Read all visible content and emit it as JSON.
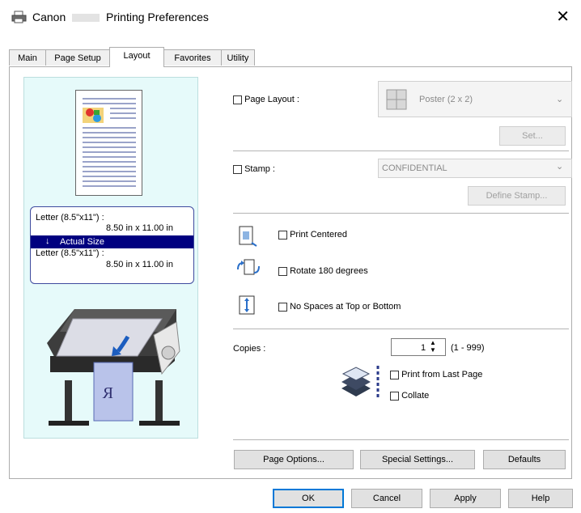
{
  "window": {
    "title_prefix": "Canon",
    "title_suffix": "Printing Preferences",
    "close_glyph": "✕"
  },
  "tabs": [
    {
      "label": "Main"
    },
    {
      "label": "Page Setup"
    },
    {
      "label": "Layout"
    },
    {
      "label": "Favorites"
    },
    {
      "label": "Utility"
    }
  ],
  "active_tab": "Layout",
  "preview": {
    "paper_from_name": "Letter (8.5\"x11\") :",
    "paper_from_size": "8.50 in x 11.00 in",
    "scaling_label": "Actual Size",
    "paper_to_name": "Letter (8.5\"x11\") :",
    "paper_to_size": "8.50 in x 11.00 in",
    "printout_letter": "R"
  },
  "page_layout": {
    "label": "Page Layout :",
    "checked": false,
    "value": "Poster (2 x 2)",
    "set_button": "Set..."
  },
  "stamp": {
    "label": "Stamp :",
    "checked": false,
    "value": "CONFIDENTIAL",
    "define_button": "Define Stamp..."
  },
  "options": {
    "print_centered": "Print Centered",
    "rotate_180": "Rotate 180 degrees",
    "no_spaces": "No Spaces at Top or Bottom"
  },
  "copies": {
    "label": "Copies :",
    "value": "1",
    "range": "(1 - 999)",
    "print_from_last": "Print from Last Page",
    "collate": "Collate"
  },
  "bottom_buttons": {
    "page_options": "Page Options...",
    "special_settings": "Special Settings...",
    "defaults": "Defaults"
  },
  "dialog_buttons": {
    "ok": "OK",
    "cancel": "Cancel",
    "apply": "Apply",
    "help": "Help"
  },
  "colors": {
    "selection": "#000080",
    "preview_bg": "#e6fafa",
    "accent": "#0078d7"
  }
}
